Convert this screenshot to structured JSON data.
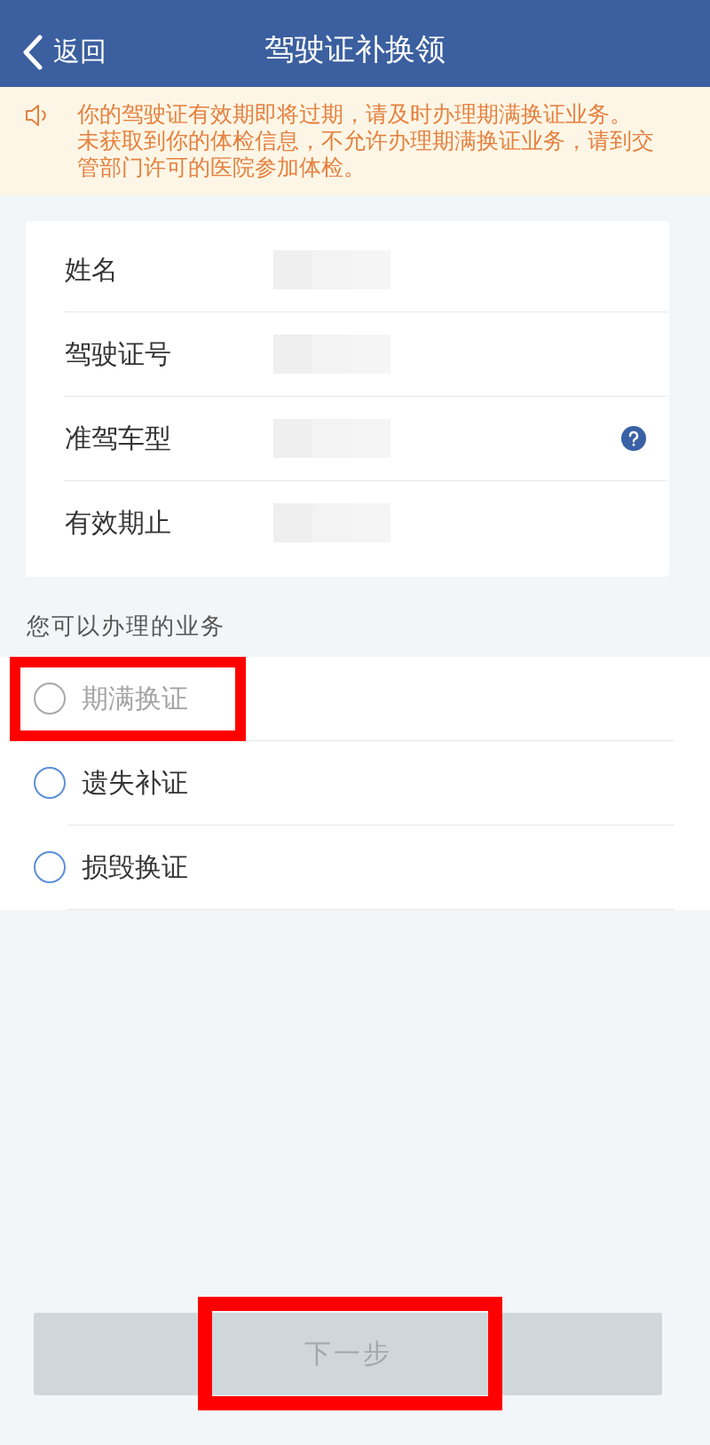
{
  "header": {
    "back_label": "返回",
    "title": "驾驶证补换领"
  },
  "notice": {
    "messages": [
      "你的驾驶证有效期即将过期，请及时办理期满换证业务。",
      "未获取到你的体检信息，不允许办理期满换证业务，请到交管部门许可的医院参加体检。"
    ]
  },
  "license_fields": [
    {
      "label": "姓名",
      "redacted": true,
      "help": false
    },
    {
      "label": "驾驶证号",
      "redacted": true,
      "help": false
    },
    {
      "label": "准驾车型",
      "redacted": true,
      "help": true
    },
    {
      "label": "有效期止",
      "redacted": true,
      "help": false
    }
  ],
  "services": {
    "heading": "您可以办理的业务",
    "options": [
      {
        "label": "期满换证",
        "selected": false,
        "disabled": true,
        "highlighted": true
      },
      {
        "label": "遗失补证",
        "selected": false,
        "disabled": false,
        "highlighted": false
      },
      {
        "label": "损毁换证",
        "selected": false,
        "disabled": false,
        "highlighted": false
      }
    ]
  },
  "next_button": {
    "label": "下一步",
    "disabled": true,
    "highlighted": true
  }
}
